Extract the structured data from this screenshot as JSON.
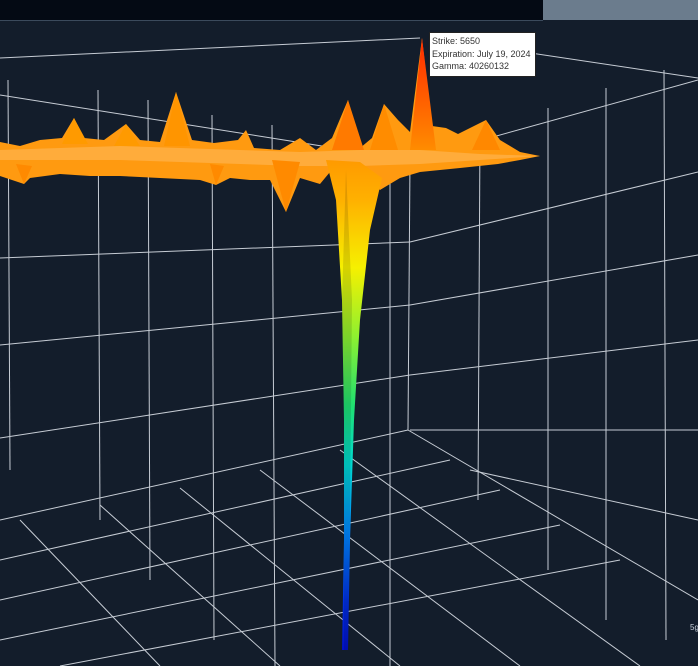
{
  "chart_data": {
    "type": "surface3d",
    "title": "",
    "xlabel": "",
    "ylabel": "",
    "zlabel": "",
    "colorscale": [
      "#0010d0",
      "#0090ff",
      "#00e0c0",
      "#60f040",
      "#f0f000",
      "#ffb000",
      "#ff8000",
      "#ff3000"
    ],
    "background_color": "#131d2b",
    "grid": true,
    "grid_color": "#ffffff",
    "highlighted_point": {
      "strike": 5650,
      "expiration": "July 19, 2024",
      "gamma": 40260132
    },
    "ridge_profile_peaks": [
      {
        "label": "far-left",
        "relative_height": 0.35
      },
      {
        "label": "left-1",
        "relative_height": 0.55
      },
      {
        "label": "left-2",
        "relative_height": 0.75
      },
      {
        "label": "center-1",
        "relative_height": 0.6
      },
      {
        "label": "center-2",
        "relative_height": 0.55
      },
      {
        "label": "peak",
        "relative_height": 1.0
      },
      {
        "label": "right-1",
        "relative_height": 0.4
      },
      {
        "label": "right-2",
        "relative_height": 0.45
      }
    ],
    "trough": {
      "relative_depth": -4.0
    }
  },
  "tooltip": {
    "strike_line": "Strike: 5650",
    "expiration_line": "Expiration: July 19, 2024",
    "gamma_line": "Gamma: 40260132"
  },
  "axis": {
    "corner_tick": "5g"
  }
}
